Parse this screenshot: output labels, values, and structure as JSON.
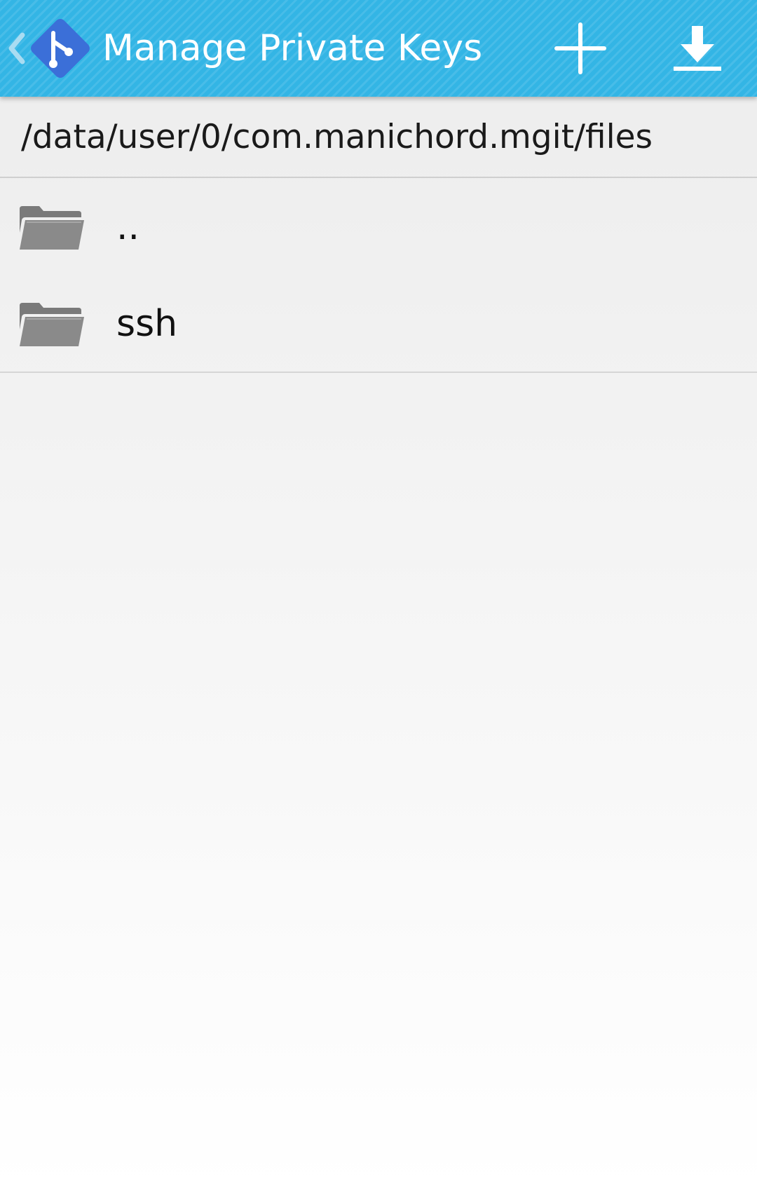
{
  "action_bar": {
    "title": "Manage Private Keys",
    "logo_icon": "git-logo-icon",
    "back_icon": "up-caret-icon",
    "actions": [
      {
        "name": "add",
        "icon": "plus-icon"
      },
      {
        "name": "import",
        "icon": "download-icon"
      }
    ],
    "colors": {
      "background": "#33b5e5",
      "logo": "#3b6fd8",
      "foreground": "#ffffff"
    }
  },
  "path": "/data/user/0/com.manichord.mgit/files",
  "files": [
    {
      "name": "..",
      "icon": "folder-icon"
    },
    {
      "name": "ssh",
      "icon": "folder-icon"
    }
  ]
}
